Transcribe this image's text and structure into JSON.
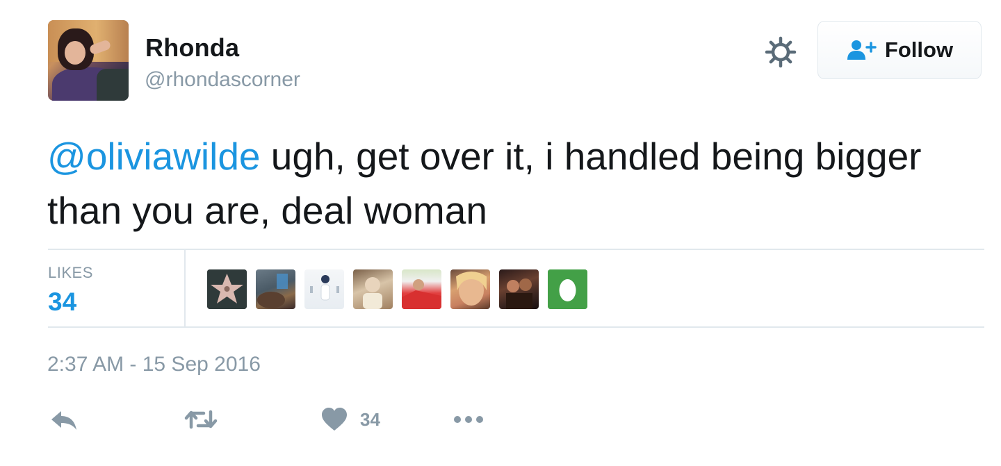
{
  "header": {
    "display_name": "Rhonda",
    "handle": "@rhondascorner",
    "settings_icon": "gear-icon",
    "follow_icon": "follow-user-icon",
    "follow_label": "Follow"
  },
  "tweet": {
    "mention": "@oliviawilde",
    "text": " ugh, get over it, i handled being bigger than you are, deal woman"
  },
  "stats": {
    "likes_label": "LIKES",
    "likes_count": "34",
    "liker_avatars": [
      "walk-of-fame-star",
      "person-photo",
      "person-photo",
      "person-photo",
      "person-photo",
      "person-photo",
      "person-photo",
      "default-egg-avatar"
    ]
  },
  "timestamp": "2:37 AM - 15 Sep 2016",
  "actions": {
    "reply_icon": "reply-icon",
    "retweet_icon": "retweet-icon",
    "like_icon": "heart-icon",
    "like_count": "34",
    "more_icon": "more-icon"
  },
  "colors": {
    "link": "#1b95e0",
    "muted": "#8899a6",
    "text": "#14171a",
    "border": "#e1e8ed"
  }
}
